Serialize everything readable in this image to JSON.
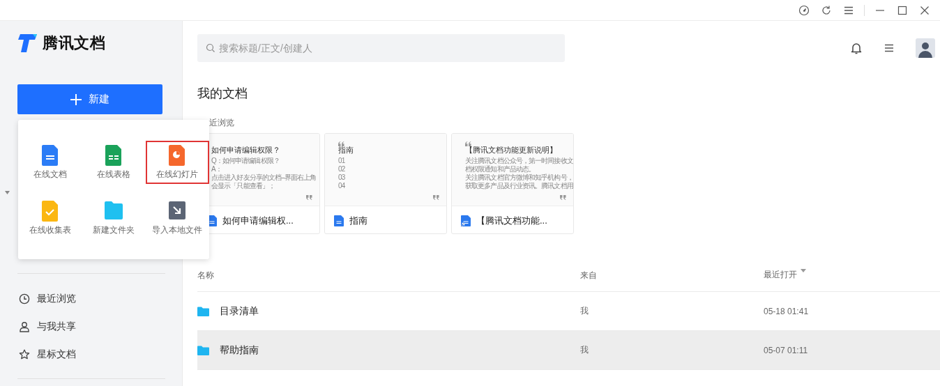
{
  "logo": {
    "name": "腾讯文档"
  },
  "new_button": {
    "label": "新建"
  },
  "new_menu": [
    {
      "kind": "doc",
      "label": "在线文档",
      "selected": false
    },
    {
      "kind": "sheet",
      "label": "在线表格",
      "selected": false
    },
    {
      "kind": "slide",
      "label": "在线幻灯片",
      "selected": true
    },
    {
      "kind": "form",
      "label": "在线收集表",
      "selected": false
    },
    {
      "kind": "folder",
      "label": "新建文件夹",
      "selected": false
    },
    {
      "kind": "import",
      "label": "导入本地文件",
      "selected": false
    }
  ],
  "sidebar": {
    "items": [
      {
        "kind": "recent",
        "label": "最近浏览"
      },
      {
        "kind": "shared",
        "label": "与我共享"
      },
      {
        "kind": "starred",
        "label": "星标文档"
      }
    ]
  },
  "search": {
    "placeholder": "搜索标题/正文/创建人"
  },
  "page_title": "我的文档",
  "recent_label": "近浏览",
  "cards": [
    {
      "kind": "doc",
      "open_quote": false,
      "preview_title": "如何申请编辑权限？",
      "preview_lines": [
        "Q：如何申请编辑权限？",
        "A：",
        "点击进入好友分享的文档--界面右上角",
        "会显示「只能查看」；"
      ],
      "name": "如何申请编辑权..."
    },
    {
      "kind": "doc",
      "open_quote": true,
      "preview_title": "指南",
      "preview_lines": [
        "01",
        "02",
        "03",
        "04"
      ],
      "name": "指南"
    },
    {
      "kind": "linked",
      "open_quote": true,
      "preview_title": "【腾讯文档功能更新说明】",
      "preview_lines": [
        "关注腾讯文档公众号，第一时间接收文",
        "档权限通知和产品动态。",
        "关注腾讯文档官方微博和知乎机构号，",
        "获取更多产品及行业资讯。腾讯文档用"
      ],
      "name": "【腾讯文档功能..."
    }
  ],
  "table": {
    "columns": [
      "名称",
      "来自",
      "最近打开"
    ],
    "rows": [
      {
        "name": "目录清单",
        "from": "我",
        "opened": "05-18 01:41",
        "selected": false
      },
      {
        "name": "帮助指南",
        "from": "我",
        "opened": "05-07 01:11",
        "selected": true
      }
    ]
  }
}
